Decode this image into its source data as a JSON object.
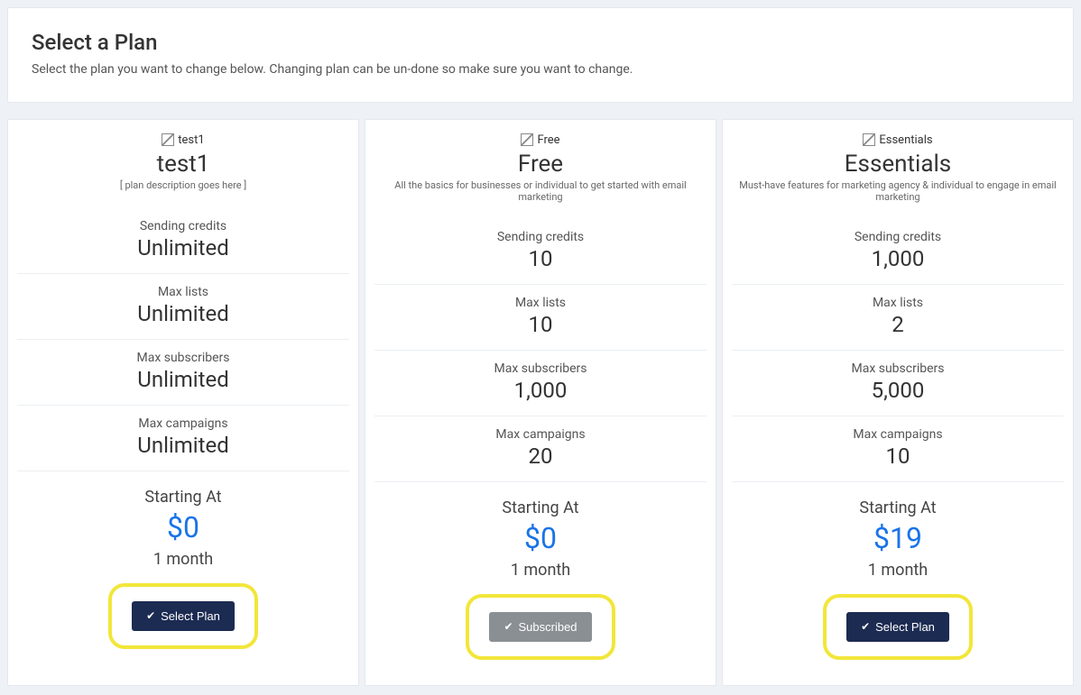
{
  "header": {
    "title": "Select a Plan",
    "subtitle": "Select the plan you want to change below. Changing plan can be un-done so make sure you want to change."
  },
  "feature_labels": {
    "sending_credits": "Sending credits",
    "max_lists": "Max lists",
    "max_subscribers": "Max subscribers",
    "max_campaigns": "Max campaigns",
    "starting_at": "Starting At"
  },
  "buttons": {
    "select": "Select Plan",
    "subscribed": "Subscribed"
  },
  "plans": [
    {
      "img_alt": "test1",
      "name": "test1",
      "description": "[ plan description goes here ]",
      "sending_credits": "Unlimited",
      "max_lists": "Unlimited",
      "max_subscribers": "Unlimited",
      "max_campaigns": "Unlimited",
      "price": "$0",
      "term": "1 month",
      "subscribed": false
    },
    {
      "img_alt": "Free",
      "name": "Free",
      "description": "All the basics for businesses or individual to get started with email marketing",
      "sending_credits": "10",
      "max_lists": "10",
      "max_subscribers": "1,000",
      "max_campaigns": "20",
      "price": "$0",
      "term": "1 month",
      "subscribed": true
    },
    {
      "img_alt": "Essentials",
      "name": "Essentials",
      "description": "Must-have features for marketing agency & individual to engage in email marketing",
      "sending_credits": "1,000",
      "max_lists": "2",
      "max_subscribers": "5,000",
      "max_campaigns": "10",
      "price": "$19",
      "term": "1 month",
      "subscribed": false
    }
  ]
}
